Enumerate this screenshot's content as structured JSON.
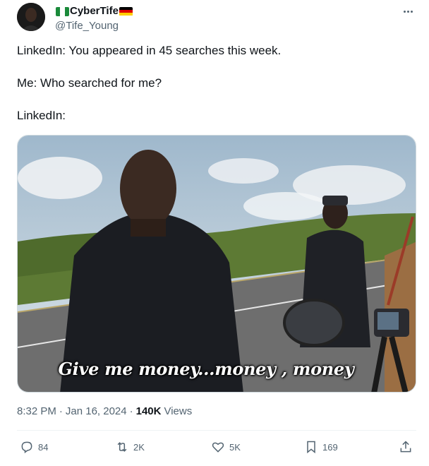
{
  "author": {
    "display_name": "CyberTife",
    "handle": "@Tife_Young"
  },
  "tweet": {
    "lines": [
      "LinkedIn: You appeared in 45 searches this week.",
      "Me: Who searched for me?",
      "LinkedIn:"
    ]
  },
  "media": {
    "caption": "Give me money...money , money"
  },
  "meta": {
    "time": "8:32 PM",
    "separator": "·",
    "date": "Jan 16, 2024",
    "views_count": "140K",
    "views_label": "Views"
  },
  "actions": {
    "reply_count": "84",
    "retweet_count": "2K",
    "like_count": "5K",
    "bookmark_count": "169"
  },
  "icons": [
    "avatar",
    "nigeria-flag-icon",
    "germany-flag-icon",
    "more-icon",
    "reply-icon",
    "retweet-icon",
    "like-icon",
    "bookmark-icon",
    "share-icon"
  ],
  "colors": {
    "text_primary": "#0f1419",
    "text_secondary": "#536471",
    "border": "#eff3f4"
  }
}
